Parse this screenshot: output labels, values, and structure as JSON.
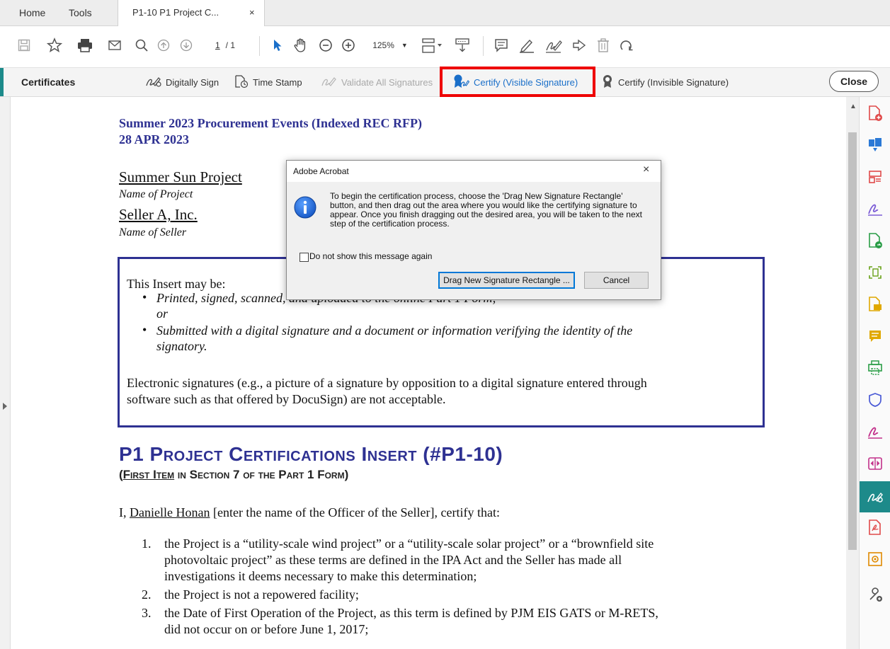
{
  "tabbar": {
    "home": "Home",
    "tools": "Tools",
    "doc_tab": "P1-10 P1 Project C...",
    "doc_tab_close": "×"
  },
  "toolbar": {
    "page_current": "1",
    "page_total": "/ 1",
    "zoom": "125%"
  },
  "certificates_bar": {
    "title": "Certificates",
    "digitally_sign": "Digitally Sign",
    "time_stamp": "Time Stamp",
    "validate_all": "Validate All Signatures",
    "certify_visible": "Certify (Visible Signature)",
    "certify_invisible": "Certify (Invisible Signature)",
    "close": "Close"
  },
  "document": {
    "header_line1": "Summer 2023 Procurement Events (Indexed REC RFP)",
    "header_line2": "28 APR 2023",
    "project_name": "Summer Sun Project",
    "project_caption": "Name of Project",
    "seller_name": "Seller A, Inc.",
    "seller_caption": "Name of Seller",
    "insert_intro": "This Insert may be:",
    "bullet1": "Printed, signed, scanned, and uploaded to the online Part 1 Form;",
    "or": "or",
    "bullet2_line1": "Submitted with a digital signature and a document or information verifying the identity of the",
    "bullet2_line2": "signatory.",
    "electronic_line1": "Electronic signatures (e.g., a picture of a signature by opposition to a digital signature entered through",
    "electronic_line2": "software such as that offered by DocuSign) are not acceptable.",
    "cert_heading": "P1 Project Certifications Insert (#P1-10)",
    "cert_sub_open": "(",
    "cert_sub_underlined": "First Item",
    "cert_sub_rest": " in Section 7 of the Part 1 Form)",
    "certify_prefix": "I, ",
    "officer_name": "Danielle Honan",
    "certify_suffix": " [enter the name of the Officer of the Seller], certify that:",
    "items": [
      {
        "num": "1.",
        "lines": [
          "the Project is a “utility-scale wind project” or a “utility-scale solar project” or a “brownfield site",
          "photovoltaic project” as these terms are defined in the IPA Act and the Seller has made all",
          "investigations it deems necessary to make this determination;"
        ]
      },
      {
        "num": "2.",
        "lines": [
          "the Project is not a repowered facility;"
        ]
      },
      {
        "num": "3.",
        "lines": [
          "the Date of First Operation of the Project, as this term is defined by PJM EIS GATS or M-RETS,",
          "did not occur on or before June 1, 2017;"
        ]
      }
    ]
  },
  "dialog": {
    "title": "Adobe Acrobat",
    "close": "×",
    "message_lines": [
      "To begin the certification process, choose the 'Drag New Signature Rectangle'",
      "button, and then drag out the area where you would like the certifying signature to",
      "appear. Once you finish dragging out the desired area, you will be taken to the next",
      "step of the certification process."
    ],
    "checkbox_label": "Do not show this message again",
    "primary_button": "Drag New Signature Rectangle ...",
    "cancel_button": "Cancel"
  },
  "colors": {
    "accent": "#1d8a8a",
    "highlight_box": "#ee0000",
    "doc_blue": "#2e3192",
    "link_blue": "#1a6fc9"
  }
}
